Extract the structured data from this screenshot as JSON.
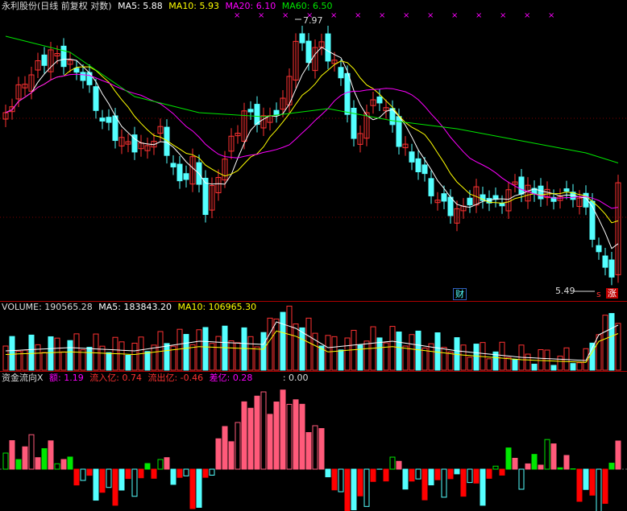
{
  "price_panel": {
    "stock_name": "永利股份",
    "period_label": "(日线 前复权 对数)",
    "ma5_label": "MA5: 5.88",
    "ma10_label": "MA10: 5.93",
    "ma20_label": "MA20: 6.10",
    "ma60_label": "MA60: 6.50",
    "high_marker": "7.97",
    "low_marker": "5.49",
    "badge_cai": "财",
    "badge_s": "s",
    "badge_zhang": "涨",
    "colors": {
      "up": "#ff3232",
      "down": "#54ffff",
      "ma5": "#ffffff",
      "ma10": "#ffff00",
      "ma20": "#ff00ff",
      "ma60": "#00e600"
    }
  },
  "volume_panel": {
    "volume_label": "VOLUME: 190565.28",
    "ma5_label": "MA5: 183843.20",
    "ma10_label": "MA10: 106965.30"
  },
  "flow_panel": {
    "title": "资金流向X",
    "amount_label": "额: 1.19",
    "inflow_label": "流入亿: 0.74",
    "outflow_label": "流出亿: -0.46",
    "diff_label": "差亿: 0.28",
    "zero_label": ": 0.00"
  },
  "chart_data": {
    "type": "candlestick",
    "title": "永利股份 (日线 前复权 对数)",
    "series": [
      {
        "name": "MA5",
        "value": 5.88
      },
      {
        "name": "MA10",
        "value": 5.93
      },
      {
        "name": "MA20",
        "value": 6.1
      },
      {
        "name": "MA60",
        "value": 6.5
      }
    ],
    "annotations": [
      {
        "text": "7.97",
        "kind": "high"
      },
      {
        "text": "5.49",
        "kind": "low"
      }
    ]
  }
}
